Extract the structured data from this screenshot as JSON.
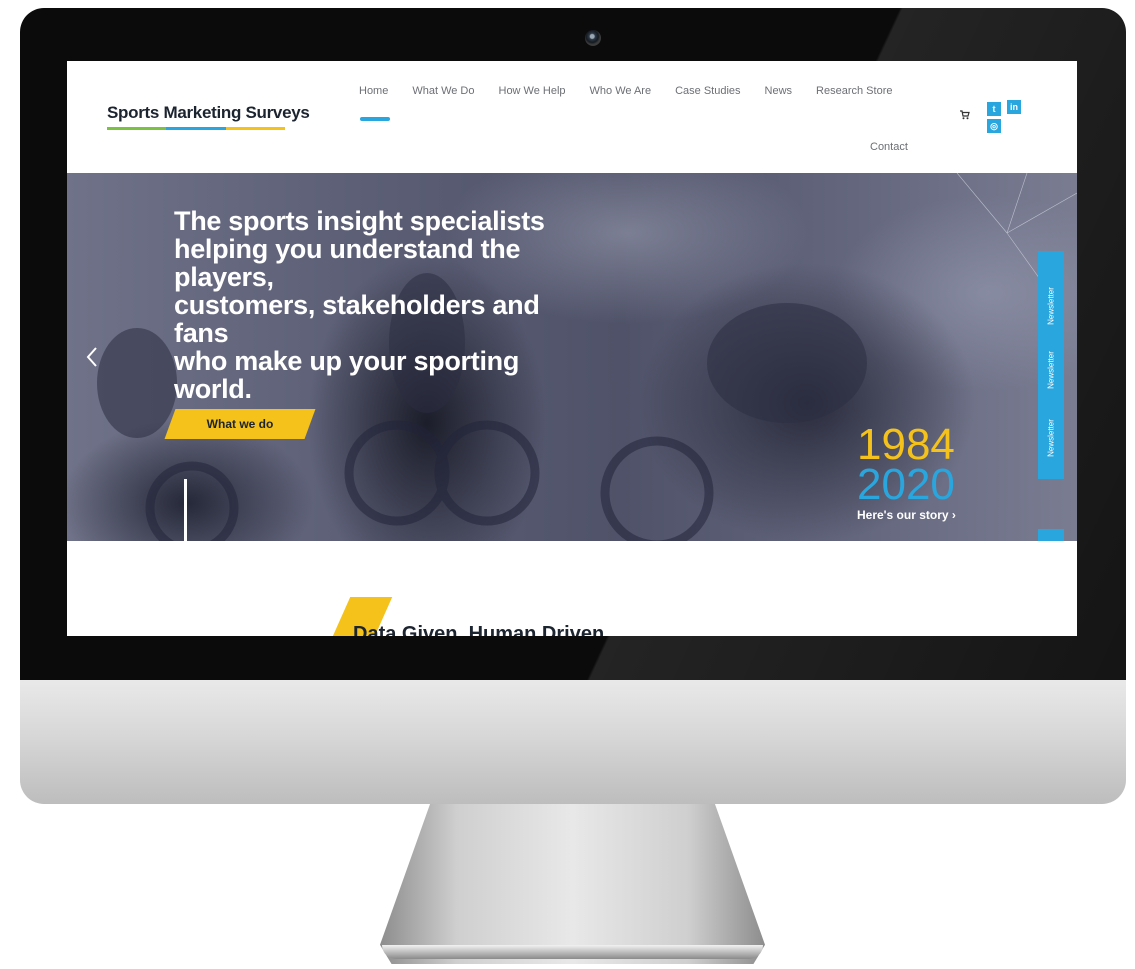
{
  "site": {
    "logo": "Sports Marketing Surveys",
    "nav": [
      "Home",
      "What We Do",
      "How We Help",
      "Who We Are",
      "Case Studies",
      "News",
      "Research Store"
    ],
    "contact": "Contact",
    "social": {
      "twitter": "t",
      "linkedin": "in",
      "instagram": "◎"
    }
  },
  "hero": {
    "headline_lines": [
      "The sports insight specialists",
      "helping you understand the players,",
      "customers, stakeholders and fans",
      "who make up your sporting world."
    ],
    "cta": "What we do",
    "year_start": "1984",
    "year_end": "2020",
    "story_link": "Here's our story ›"
  },
  "newsletter_tab": "Newsletter",
  "section_heading": "Data Given, Human Driven",
  "colors": {
    "accent_blue": "#2aa6de",
    "accent_yellow": "#f4c21b",
    "logo_green": "#7cc242",
    "text_dark": "#1c2430"
  },
  "icons": [
    "webcam-icon",
    "cart-icon",
    "twitter-icon",
    "linkedin-icon",
    "instagram-icon",
    "chevron-left-icon"
  ]
}
